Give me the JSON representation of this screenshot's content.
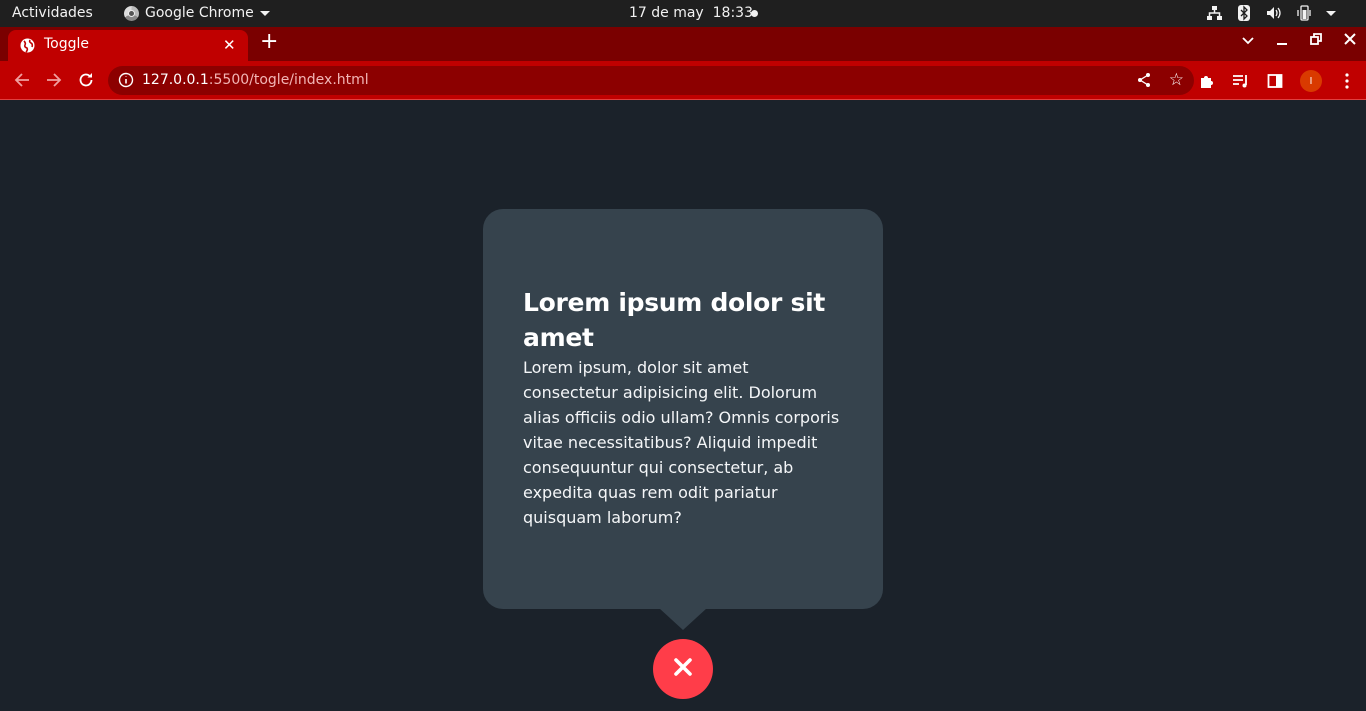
{
  "system_bar": {
    "activities": "Actividades",
    "app_name": "Google Chrome",
    "date": "17 de may",
    "time": "18:33"
  },
  "browser": {
    "tab_title": "Toggle",
    "url_host": "127.0.0.1",
    "url_path": ":5500/togle/index.html",
    "profile_initial": "I",
    "accent_color": "#c00000",
    "tabstrip_color": "#7a0000"
  },
  "page": {
    "background_color": "#1b222a",
    "card": {
      "title": "Lorem ipsum dolor sit amet",
      "body": "Lorem ipsum, dolor sit amet consectetur adipisicing elit. Dolorum alias officiis odio ullam? Omnis corporis vitae necessitatibus? Aliquid impedit consequuntur qui consectetur, ab expedita quas rem odit pariatur quisquam laborum?",
      "background_color": "#36434d"
    },
    "toggle_button": {
      "icon": "close-icon",
      "color": "#ff3d49"
    }
  }
}
